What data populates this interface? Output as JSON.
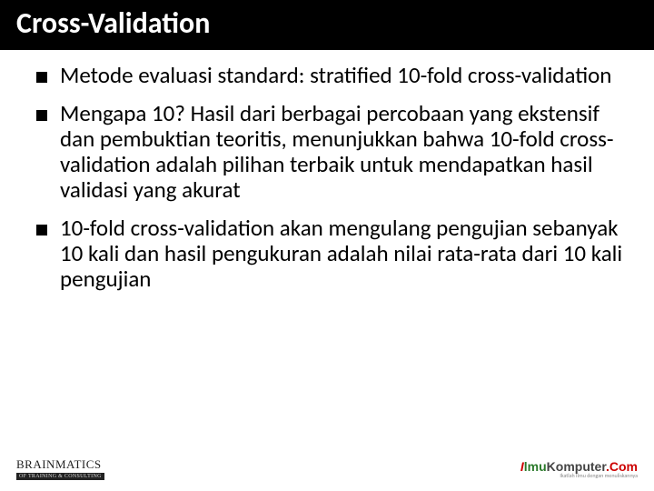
{
  "title": "Cross-Validation",
  "bullets": {
    "b1": "Metode evaluasi standard: stratified 10-fold cross-validation",
    "b2": "Mengapa 10? Hasil dari berbagai percobaan yang ekstensif  dan pembuktian teoritis, menunjukkan bahwa 10-fold cross-validation adalah pilihan terbaik untuk mendapatkan hasil validasi yang akurat",
    "b3": "10-fold cross-validation akan mengulang pengujian sebanyak 10 kali dan hasil pengukuran adalah nilai rata-rata dari 10 kali pengujian"
  },
  "footer": {
    "left_main": "BRAINMATICS",
    "left_sub": "OF TRAINING & CONSULTING",
    "right_ilmu_i": "I",
    "right_ilmu_lmu": "lmu",
    "right_komputer": "Komputer",
    "right_com": ".Com",
    "right_sub": "Ikatlah Ilmu dengan menuliskannya"
  }
}
